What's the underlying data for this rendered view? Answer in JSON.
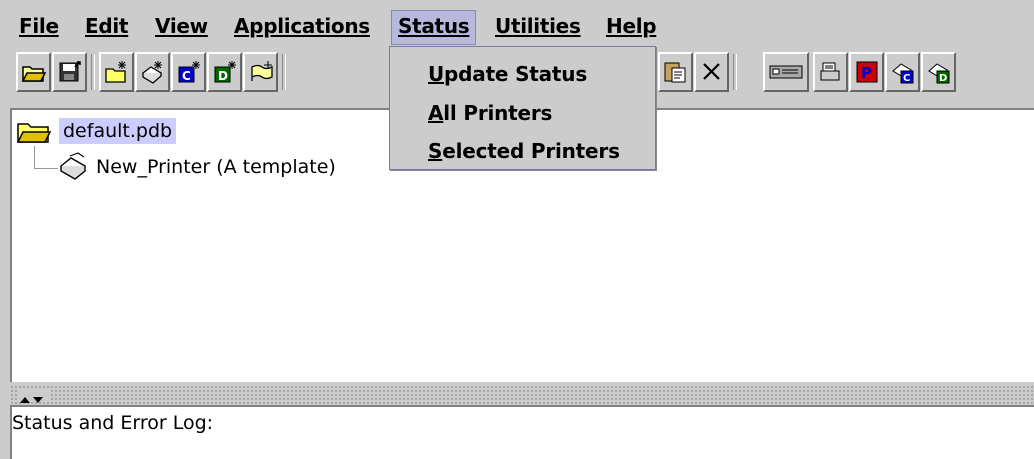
{
  "menubar": {
    "items": [
      {
        "label": "File"
      },
      {
        "label": "Edit"
      },
      {
        "label": "View"
      },
      {
        "label": "Applications"
      },
      {
        "label": "Status"
      },
      {
        "label": "Utilities"
      },
      {
        "label": "Help"
      }
    ],
    "active": "Status"
  },
  "status_menu": {
    "items": [
      {
        "first": "U",
        "rest": "pdate Status"
      },
      {
        "first": "A",
        "rest": "ll Printers"
      },
      {
        "first": "S",
        "rest": "elected Printers"
      }
    ]
  },
  "toolbar": {
    "icons": [
      "open-folder-icon",
      "save-disk-icon",
      "new-folder-icon",
      "new-printer-icon",
      "new-c-printer-icon",
      "new-d-printer-icon",
      "new-flag-icon",
      "cut-icon",
      "paste-icon",
      "delete-icon",
      "device-icon",
      "printer-status-icon",
      "printer-p-icon",
      "printer-c-icon",
      "printer-d-icon"
    ]
  },
  "tree": {
    "root_label": "default.pdb",
    "child_label": "New_Printer (A template)"
  },
  "log": {
    "label": "Status and Error Log:"
  },
  "colors": {
    "background": "#cccccc",
    "selection": "#ccccff",
    "menu_active": "#b8b8dc"
  }
}
